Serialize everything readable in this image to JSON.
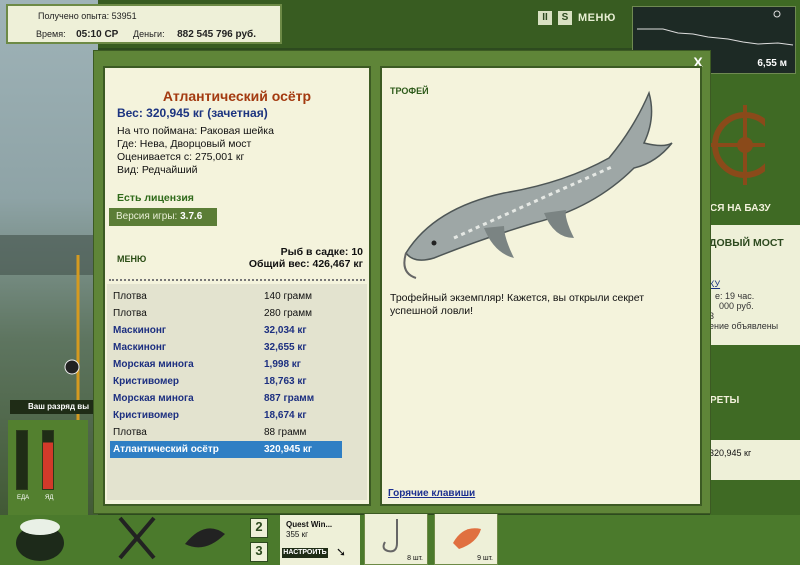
{
  "status": {
    "experience_label": "Получено опыта:",
    "experience_value": "53951",
    "time_label": "Время:",
    "time_value": "05:10 СР",
    "money_label": "Деньги:",
    "money_value": "882 545 796 руб."
  },
  "top_controls": {
    "pause": "II",
    "sound": "S",
    "menu": "МЕНЮ"
  },
  "depth": {
    "value": "6,55 м"
  },
  "right_side": {
    "base_fragment": "СЯ НА БАЗУ",
    "bridge_fragment": "ДОВЫЙ МОСТ",
    "line1": "КУ",
    "line2": "е: 19 час.",
    "line3": "000 руб.",
    "line4": "3",
    "line5": "ение объявлены",
    "records_fragment": "РЕТЫ",
    "weight_fragment": "320,945 кг"
  },
  "left_bottom": {
    "rank_label": "Ваш разряд вы",
    "food_label": "ЕДА",
    "energy_label": "ЯД"
  },
  "bottom_bar": {
    "slot2": "2",
    "slot3": "3",
    "quest_name": "Quest Win...",
    "quest_weight": "355 кг",
    "setup_button": "НАСТРОИТЬ",
    "item1_count": "8 шт.",
    "item2_count": "9 шт."
  },
  "modal": {
    "close": "X",
    "fish": {
      "title": "Атлантический осётр",
      "weight": "Вес: 320,945 кг (зачетная)",
      "caught_on": "На что поймана: Раковая шейка",
      "location": "Где: Нева, Дворцовый мост",
      "value": "Оценивается с: 275,001 кг",
      "kind": "Вид: Редчайший"
    },
    "license": "Есть лицензия",
    "version_label": "Версия игры:",
    "version_value": "3.7.6",
    "menu_link": "МЕНЮ",
    "keep_count": "Рыб в садке: 10",
    "keep_weight": "Общий вес: 426,467 кг",
    "catch_list": [
      {
        "name": "Плотва",
        "weight": "140 грамм",
        "style": "plain"
      },
      {
        "name": "Плотва",
        "weight": "280 грамм",
        "style": "plain"
      },
      {
        "name": "Маскинонг",
        "weight": "32,034 кг",
        "style": "bold"
      },
      {
        "name": "Маскинонг",
        "weight": "32,655 кг",
        "style": "bold"
      },
      {
        "name": "Морская минога",
        "weight": "1,998 кг",
        "style": "bold"
      },
      {
        "name": "Кристивомер",
        "weight": "18,763 кг",
        "style": "bold"
      },
      {
        "name": "Морская минога",
        "weight": "887 грамм",
        "style": "bold"
      },
      {
        "name": "Кристивомер",
        "weight": "18,674 кг",
        "style": "bold"
      },
      {
        "name": "Плотва",
        "weight": "88 грамм",
        "style": "plain"
      },
      {
        "name": "Атлантический осётр",
        "weight": "320,945 кг",
        "style": "sel"
      }
    ],
    "trophy_label": "ТРОФЕЙ",
    "trophy_text": "Трофейный экземпляр! Кажется, вы открыли секрет успешной ловли!",
    "hotkeys": "Горячие клавиши"
  }
}
